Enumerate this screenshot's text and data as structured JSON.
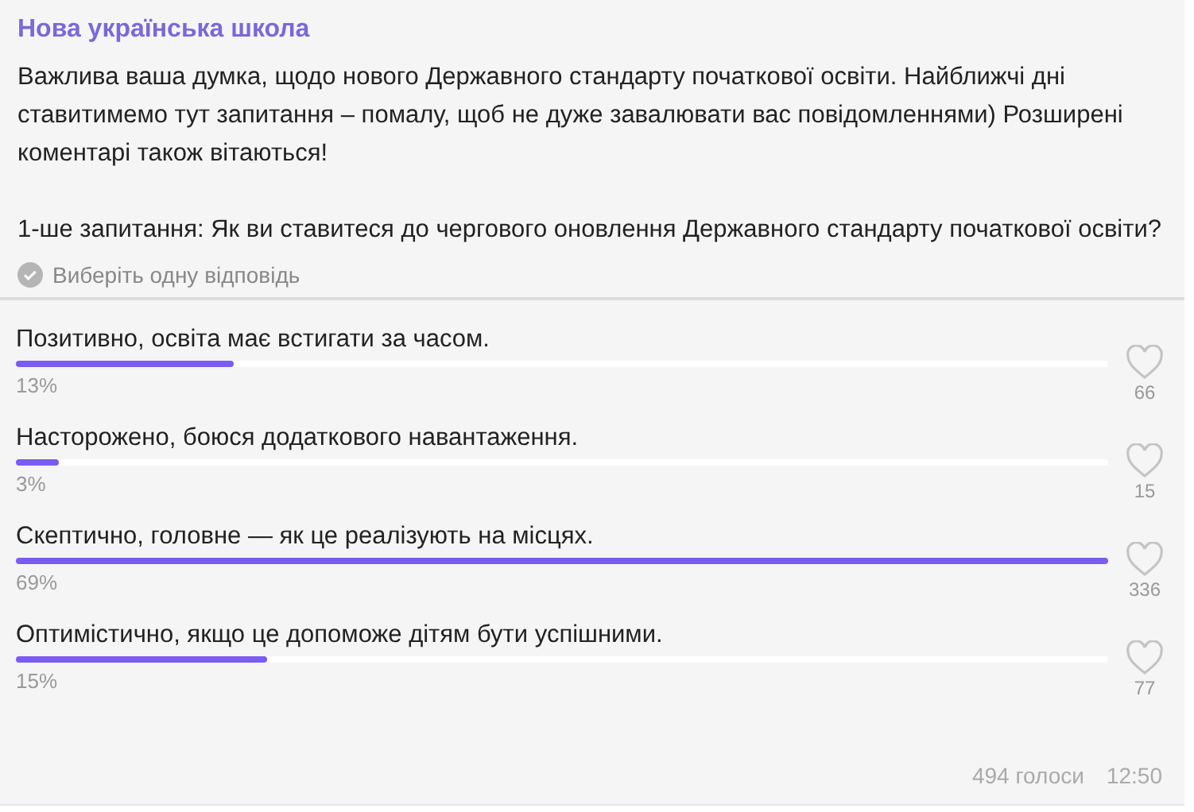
{
  "channel": {
    "title": "Нова українська школа"
  },
  "message": {
    "paragraphs": [
      "Важлива ваша думка, щодо нового Державного стандарту початкової освіти. Найближчі дні ставитимемо тут запитання – помалу, щоб не дуже завалювати вас повідомленнями) Розширені коментарі також вітаються!",
      "1-ше запитання: Як ви ставитеся до чергового оновлення Державного стандарту початкової освіти?"
    ]
  },
  "poll": {
    "hint": "Виберіть одну відповідь",
    "options": [
      {
        "text": "Позитивно, освіта має встигати за часом.",
        "percent": "13%",
        "level": 0.2,
        "likes": "66"
      },
      {
        "text": "Насторожено, боюся додаткового навантаження.",
        "percent": "3%",
        "level": 0.04,
        "likes": "15"
      },
      {
        "text": "Скептично, головне — як це реалізують на місцях.",
        "percent": "69%",
        "level": 1.0,
        "likes": "336"
      },
      {
        "text": "Оптимістично, якщо це допоможе дітям бути успішними.",
        "percent": "15%",
        "level": 0.23,
        "likes": "77"
      }
    ],
    "votes": "494 голоси",
    "time": "12:50"
  }
}
